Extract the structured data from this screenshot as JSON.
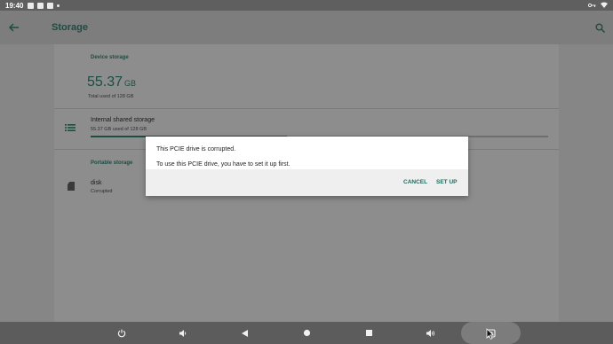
{
  "status_bar": {
    "time": "19:40"
  },
  "app_bar": {
    "title": "Storage"
  },
  "device_storage": {
    "header": "Device storage",
    "used_value": "55.37",
    "used_unit": "GB",
    "total_line": "Total used of 128 GB",
    "internal": {
      "title": "Internal shared storage",
      "subtitle": "55.37 GB used of 128 GB",
      "usage_fraction": 0.43
    }
  },
  "portable_storage": {
    "header": "Portable storage",
    "items": [
      {
        "title": "disk",
        "subtitle": "Corrupted"
      }
    ]
  },
  "dialog": {
    "message_line1": "This PCIE drive is corrupted.",
    "message_line2": "To use this PCIE drive, you have to set it up first.",
    "cancel_label": "CANCEL",
    "setup_label": "SET UP"
  },
  "colors": {
    "accent": "#1d4c42",
    "dialog_button": "#1d6a5c"
  }
}
